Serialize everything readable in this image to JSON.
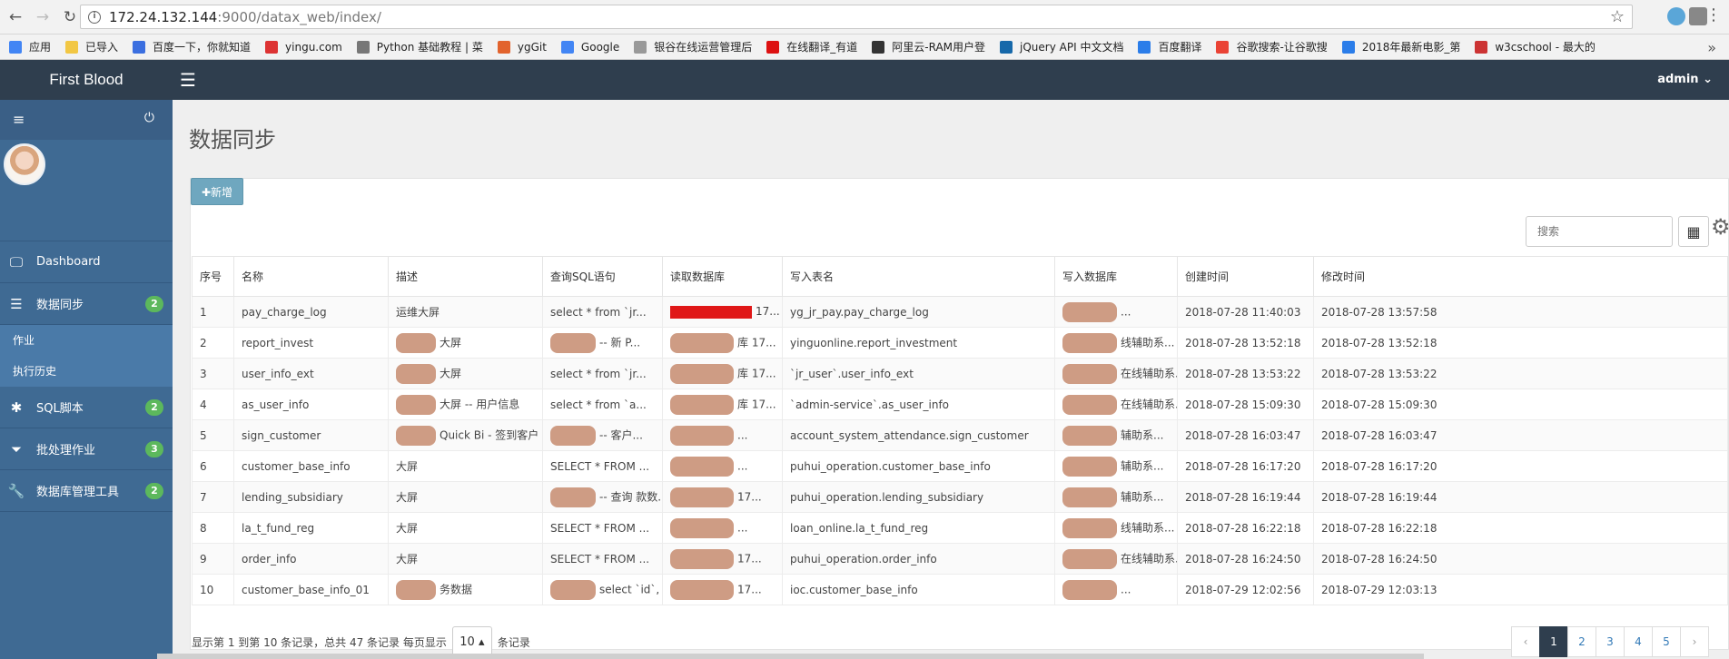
{
  "browser": {
    "url_host": "172.24.132.144",
    "url_rest": ":9000/datax_web/index/",
    "bookmarks": [
      {
        "label": "应用",
        "color": "#4285f4"
      },
      {
        "label": "已导入",
        "color": "#f2c744"
      },
      {
        "label": "百度一下，你就知道",
        "color": "#3b6fe0"
      },
      {
        "label": "yingu.com",
        "color": "#d33"
      },
      {
        "label": "Python 基础教程 | 菜",
        "color": "#777"
      },
      {
        "label": "ygGit",
        "color": "#e2632d"
      },
      {
        "label": "Google",
        "color": "#4285f4"
      },
      {
        "label": "银谷在线运营管理后",
        "color": "#999"
      },
      {
        "label": "在线翻译_有道",
        "color": "#d11"
      },
      {
        "label": "阿里云-RAM用户登",
        "color": "#333"
      },
      {
        "label": "jQuery API 中文文档",
        "color": "#1769aa"
      },
      {
        "label": "百度翻译",
        "color": "#2b7de9"
      },
      {
        "label": "谷歌搜索-让谷歌搜",
        "color": "#ea4335"
      },
      {
        "label": "2018年最新电影_第",
        "color": "#2b7de9"
      },
      {
        "label": "w3cschool - 最大的",
        "color": "#c33"
      }
    ]
  },
  "app": {
    "brand": "First Blood",
    "user": "admin"
  },
  "sidebar": {
    "items": [
      {
        "label": "Dashboard",
        "icon": "monitor-icon",
        "badge": ""
      },
      {
        "label": "数据同步",
        "icon": "list-icon",
        "badge": "2"
      },
      {
        "label": "SQL脚本",
        "icon": "asterisk-icon",
        "badge": "2"
      },
      {
        "label": "批处理作业",
        "icon": "tag-icon",
        "badge": "3"
      },
      {
        "label": "数据库管理工具",
        "icon": "wrench-icon",
        "badge": "2"
      }
    ],
    "subitems": [
      "作业",
      "执行历史"
    ]
  },
  "main": {
    "title": "数据同步",
    "add_button": "✚新增",
    "search_placeholder": "搜索"
  },
  "table": {
    "headers": [
      "序号",
      "名称",
      "描述",
      "查询SQL语句",
      "读取数据库",
      "写入表名",
      "写入数据库",
      "创建时间",
      "修改时间"
    ],
    "rows": [
      [
        "1",
        "pay_charge_log",
        "运维大屏",
        "select * from `jr...",
        "17...",
        "yg_jr_pay.pay_charge_log",
        "...",
        "2018-07-28 11:40:03",
        "2018-07-28 13:57:58"
      ],
      [
        "2",
        "report_invest",
        "大屏",
        "-- 新 P...",
        "库 17...",
        "yinguonline.report_investment",
        "线辅助系...",
        "2018-07-28 13:52:18",
        "2018-07-28 13:52:18"
      ],
      [
        "3",
        "user_info_ext",
        "大屏",
        "select * from `jr...",
        "库 17...",
        "`jr_user`.user_info_ext",
        "在线辅助系...",
        "2018-07-28 13:53:22",
        "2018-07-28 13:53:22"
      ],
      [
        "4",
        "as_user_info",
        "大屏 -- 用户信息",
        "select * from `a...",
        "库 17...",
        "`admin-service`.as_user_info",
        "在线辅助系...",
        "2018-07-28 15:09:30",
        "2018-07-28 15:09:30"
      ],
      [
        "5",
        "sign_customer",
        "Quick Bi - 签到客户",
        "-- 客户...",
        "...",
        "account_system_attendance.sign_customer",
        "辅助系...",
        "2018-07-28 16:03:47",
        "2018-07-28 16:03:47"
      ],
      [
        "6",
        "customer_base_info",
        "大屏",
        "SELECT * FROM ...",
        "...",
        "puhui_operation.customer_base_info",
        "辅助系...",
        "2018-07-28 16:17:20",
        "2018-07-28 16:17:20"
      ],
      [
        "7",
        "lending_subsidiary",
        "大屏",
        "-- 查询 款数...",
        "17...",
        "puhui_operation.lending_subsidiary",
        "辅助系...",
        "2018-07-28 16:19:44",
        "2018-07-28 16:19:44"
      ],
      [
        "8",
        "la_t_fund_reg",
        "大屏",
        "SELECT * FROM ...",
        "...",
        "loan_online.la_t_fund_reg",
        "线辅助系...",
        "2018-07-28 16:22:18",
        "2018-07-28 16:22:18"
      ],
      [
        "9",
        "order_info",
        "大屏",
        "SELECT * FROM ...",
        "17...",
        "puhui_operation.order_info",
        "在线辅助系...",
        "2018-07-28 16:24:50",
        "2018-07-28 16:24:50"
      ],
      [
        "10",
        "customer_base_info_01",
        "务数据",
        "select `id`, `or...",
        "17...",
        "ioc.customer_base_info",
        "...",
        "2018-07-29 12:02:56",
        "2018-07-29 12:03:13"
      ]
    ]
  },
  "footer": {
    "range_text": "显示第 1 到第 10 条记录，总共 47 条记录 每页显示",
    "page_size": "10",
    "suffix": "条记录",
    "pages": [
      "‹",
      "1",
      "2",
      "3",
      "4",
      "5",
      "›"
    ],
    "active_page": "1"
  },
  "colors": {
    "topbar": "#2f3e4e",
    "sidebar": "#3f6a93",
    "badge": "#5cb85c",
    "add_button": "#6fa7bf"
  }
}
